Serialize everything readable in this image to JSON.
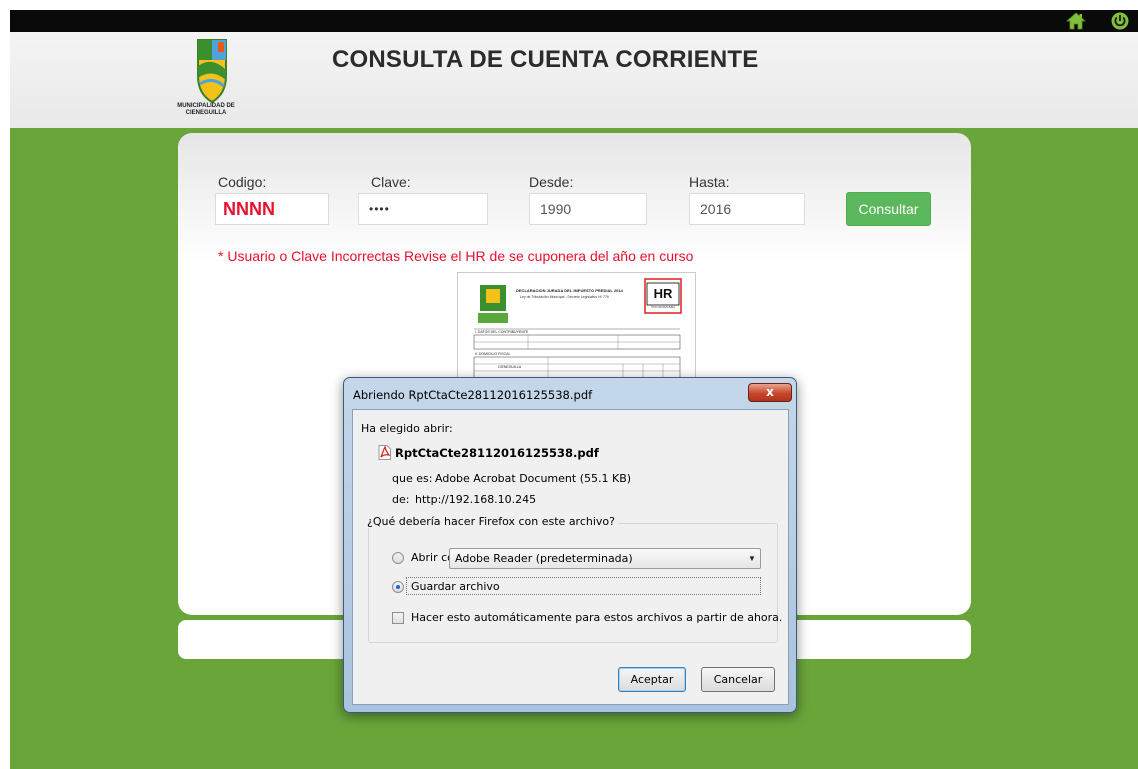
{
  "app": {
    "title": "CONSULTA DE CUENTA CORRIENTE",
    "logo_text": "MUNICIPALIDAD DE\nCIENEGUILLA",
    "top_icons": [
      "home-icon",
      "power-icon"
    ],
    "colors": {
      "green": "#6aa53a",
      "button": "#5cb85c",
      "error": "#e8102e"
    }
  },
  "form": {
    "codigo_label": "Codigo:",
    "codigo_value": "NNNN",
    "clave_label": "Clave:",
    "clave_value": "••••",
    "desde_label": "Desde:",
    "desde_value": "1990",
    "hasta_label": "Hasta:",
    "hasta_value": "2016",
    "submit_label": "Consultar",
    "error": "* Usuario o Clave Incorrectas Revise el HR de se cuponera del año en curso"
  },
  "hr_document": {
    "title": "DECLARACION JURADA DEL IMPUESTO PREDIAL 2014",
    "subtitle": "Ley de Tributación Municipal - Decreto Legislativo Nº 776",
    "badge": "HR",
    "badge_caption": "HOJA DE RESUMEN",
    "section1": "I. DATOS DEL CONTRIBUYENTE",
    "section2": "II. DOMICILIO FISCAL",
    "district": "CIENEGUILLA"
  },
  "dialog": {
    "title": "Abriendo RptCtaCte28112016125538.pdf",
    "close_label": "x",
    "chosen_label": "Ha elegido abrir:",
    "filename": "RptCtaCte28112016125538.pdf",
    "type_label": "que es:",
    "type_value": "Adobe Acrobat Document (55.1 KB)",
    "from_label": "de:",
    "from_value": "http://192.168.10.245",
    "question": "¿Qué debería hacer Firefox con este archivo?",
    "open_with_label": "Abrir con",
    "open_with_value": "Adobe Reader  (predeterminada)",
    "save_label": "Guardar archivo",
    "auto_label": "Hacer esto automáticamente para estos archivos a partir de ahora.",
    "accept_label": "Aceptar",
    "cancel_label": "Cancelar"
  }
}
